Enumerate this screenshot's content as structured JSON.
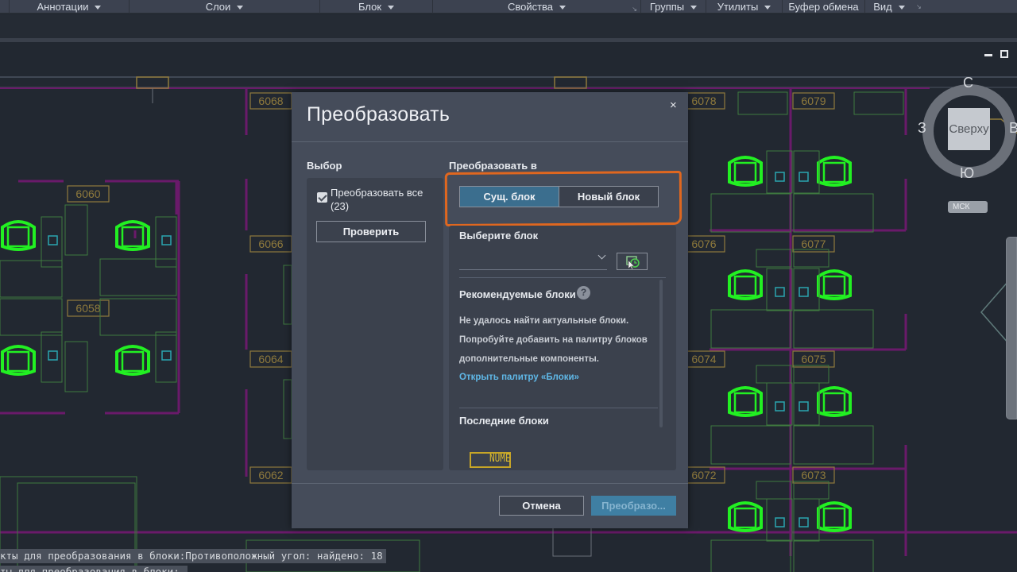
{
  "ribbon": {
    "panels": [
      {
        "label": "Аннотации",
        "dropdown": true
      },
      {
        "label": "Слои",
        "dropdown": true
      },
      {
        "label": "Блок",
        "dropdown": true
      },
      {
        "label": "Свойства",
        "dropdown": true,
        "launcher": true
      },
      {
        "label": "Группы",
        "dropdown": true
      },
      {
        "label": "Утилиты",
        "dropdown": true
      },
      {
        "label": "Буфер обмена",
        "dropdown": false
      },
      {
        "label": "Вид",
        "dropdown": true,
        "launcher": true
      }
    ]
  },
  "viewcube": {
    "face": "Сверху",
    "north": "С",
    "south": "Ю",
    "west": "З",
    "east": "В",
    "wcs": "МСК"
  },
  "drawing": {
    "room_labels": [
      "6068",
      "6060",
      "6066",
      "6058",
      "6064",
      "6062",
      "6078",
      "6079",
      "6076",
      "6077",
      "6074",
      "6075",
      "6072",
      "6073"
    ],
    "colors": {
      "chair": "#22f022",
      "room_tag": "#8f7a3c",
      "wall": "#6a1a6a",
      "furniture": "#3f7a3f",
      "phone": "#2aa6b0"
    }
  },
  "command_line": {
    "line1": "кты для преобразования в блоки:Противоположный угол: найдено: 18",
    "line2": "ты для преобразования в блоки:"
  },
  "dialog": {
    "title": "Преобразовать",
    "close_label": "×",
    "selection": {
      "label": "Выбор",
      "convert_all_label": "Преобразовать все (23)",
      "convert_all_checked": true,
      "check_button": "Проверить"
    },
    "convert_to": {
      "label": "Преобразовать в",
      "options": [
        "Сущ. блок",
        "Новый блок"
      ],
      "selected": "Сущ. блок"
    },
    "choose_block": {
      "label": "Выберите блок",
      "value": "",
      "pick_button_icon": "pick-block-icon"
    },
    "recommended": {
      "label": "Рекомендуемые блоки",
      "message_lines": [
        "Не удалось найти актуальные блоки.",
        "Попробуйте добавить на палитру блоков",
        "дополнительные компоненты."
      ],
      "link": "Открыть палитру «Блоки»"
    },
    "recent": {
      "label": "Последние блоки",
      "items": [
        "NUME"
      ]
    },
    "buttons": {
      "cancel": "Отмена",
      "convert": "Преобразо..."
    },
    "accent_color": "#3f7fa3",
    "annotation_color": "#e0671f"
  }
}
